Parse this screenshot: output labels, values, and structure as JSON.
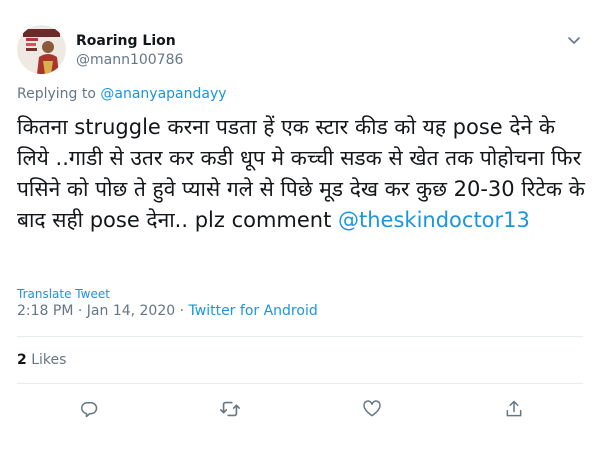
{
  "tweet": {
    "author_name": "Roaring Lion",
    "author_handle": "@mann100786",
    "replying_prefix": "Replying to",
    "replying_to": "@ananyapandayy",
    "text_main": "कितना struggle करना पडता हें एक स्टार कीड को यह pose देने के लिये ..गाडी से उतर कर कडी धूप मे कच्ची सडक से खेत तक पोहोचना फिर पसिने को पोछ ते हुवे प्यासे गले से पिछे मूड देख कर कुछ 20-30 रिटेक के बाद सही pose देना.. plz comment ",
    "text_mention": "@theskindoctor13",
    "translate_label": "Translate Tweet",
    "time": "2:18 PM",
    "date": "Jan 14, 2020",
    "source": "Twitter for Android",
    "likes_count": "2",
    "likes_label": "Likes",
    "icons": {
      "avatar": "profile-photo",
      "caret": "chevron-down-icon",
      "reply": "reply-icon",
      "retweet": "retweet-icon",
      "like": "heart-icon",
      "share": "share-icon"
    },
    "colors": {
      "link": "#1b95e0",
      "secondary_text": "#657786",
      "primary_text": "#14171a",
      "divider": "#e6ecf0"
    }
  }
}
